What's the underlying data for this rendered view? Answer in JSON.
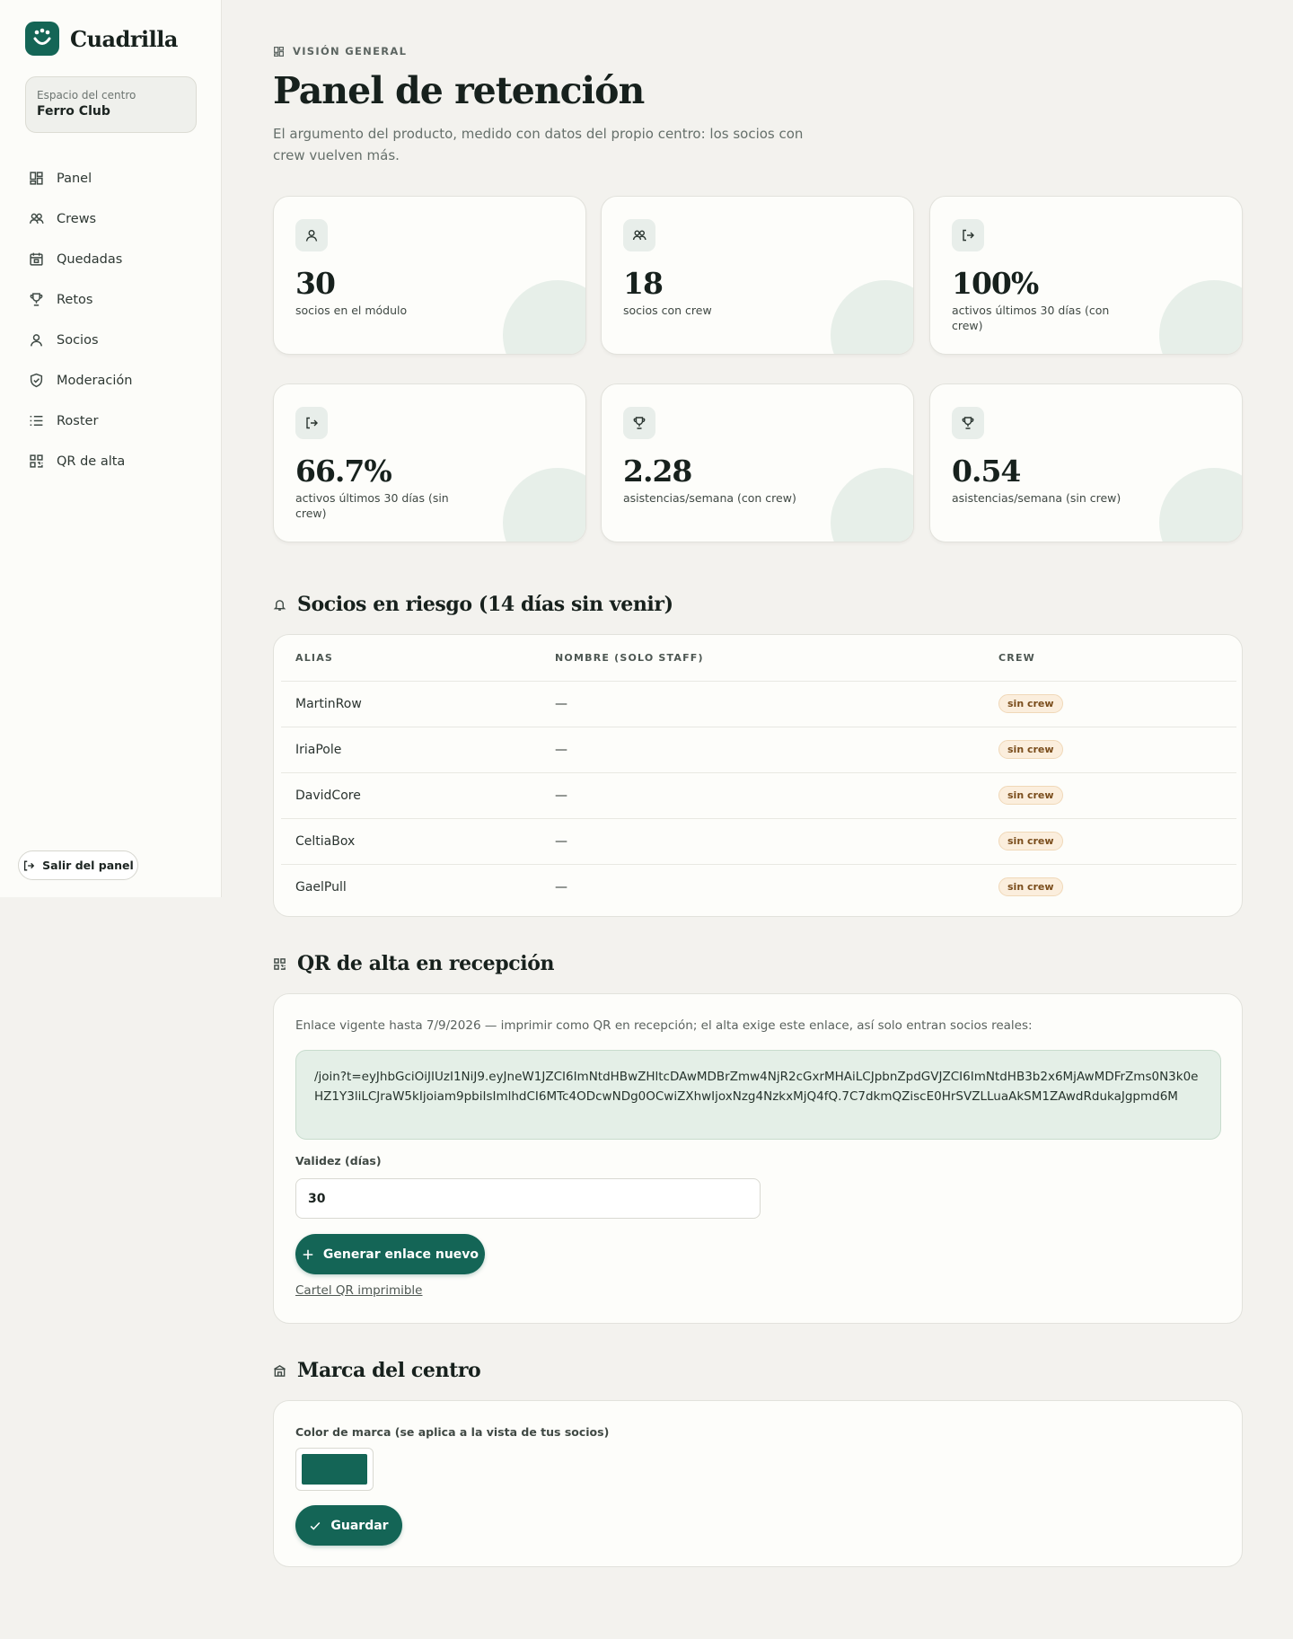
{
  "brand": {
    "name": "Cuadrilla",
    "color": "#146556"
  },
  "sidebar": {
    "space_label": "Espacio del centro",
    "space_value": "Ferro Club",
    "items": [
      {
        "label": "Panel",
        "icon": "dashboard-icon"
      },
      {
        "label": "Crews",
        "icon": "users-icon"
      },
      {
        "label": "Quedadas",
        "icon": "calendar-icon"
      },
      {
        "label": "Retos",
        "icon": "trophy-icon"
      },
      {
        "label": "Socios",
        "icon": "user-icon"
      },
      {
        "label": "Moderación",
        "icon": "shield-icon"
      },
      {
        "label": "Roster",
        "icon": "list-icon"
      },
      {
        "label": "QR de alta",
        "icon": "qr-icon"
      }
    ],
    "logout_label": "Salir del panel"
  },
  "header": {
    "eyebrow": "VISIÓN GENERAL",
    "title": "Panel de retención",
    "description": "El argumento del producto, medido con datos del propio centro: los socios con crew vuelven más."
  },
  "stats": [
    {
      "value": "30",
      "label": "socios en el módulo",
      "icon": "user-icon"
    },
    {
      "value": "18",
      "label": "socios con crew",
      "icon": "users-icon"
    },
    {
      "value": "100%",
      "label": "activos últimos 30 días (con crew)",
      "icon": "login-icon"
    },
    {
      "value": "66.7%",
      "label": "activos últimos 30 días (sin crew)",
      "icon": "login-icon"
    },
    {
      "value": "2.28",
      "label": "asistencias/semana (con crew)",
      "icon": "trophy-icon"
    },
    {
      "value": "0.54",
      "label": "asistencias/semana (sin crew)",
      "icon": "trophy-icon"
    }
  ],
  "risk": {
    "title": "Socios en riesgo (14 días sin venir)",
    "columns": [
      "ALIAS",
      "NOMBRE (SOLO STAFF)",
      "CREW"
    ],
    "rows": [
      {
        "alias": "MartinRow",
        "name": "—",
        "crew": "sin crew"
      },
      {
        "alias": "IriaPole",
        "name": "—",
        "crew": "sin crew"
      },
      {
        "alias": "DavidCore",
        "name": "—",
        "crew": "sin crew"
      },
      {
        "alias": "CeltiaBox",
        "name": "—",
        "crew": "sin crew"
      },
      {
        "alias": "GaelPull",
        "name": "—",
        "crew": "sin crew"
      }
    ]
  },
  "qr": {
    "title": "QR de alta en recepción",
    "note": "Enlace vigente hasta 7/9/2026 — imprimir como QR en recepción; el alta exige este enlace, así solo entran socios reales:",
    "link": "/join?t=eyJhbGciOiJIUzI1NiJ9.eyJneW1JZCI6ImNtdHBwZHltcDAwMDBrZmw4NjR2cGxrMHAiLCJpbnZpdGVJZCI6ImNtdHB3b2x6MjAwMDFrZms0N3k0eHZ1Y3liLCJraW5kIjoiam9pbiIsImlhdCI6MTc4ODcwNDg0OCwiZXhwIjoxNzg4NzkxMjQ4fQ.7C7dkmQZiscE0HrSVZLLuaAkSM1ZAwdRdukaJgpmd6M",
    "validity_label": "Validez (días)",
    "validity_value": "30",
    "generate_label": "Generar enlace nuevo",
    "poster_link": "Cartel QR imprimible"
  },
  "brand_section": {
    "title": "Marca del centro",
    "color_label": "Color de marca (se aplica a la vista de tus socios)",
    "color_value": "#146556",
    "save_label": "Guardar"
  }
}
